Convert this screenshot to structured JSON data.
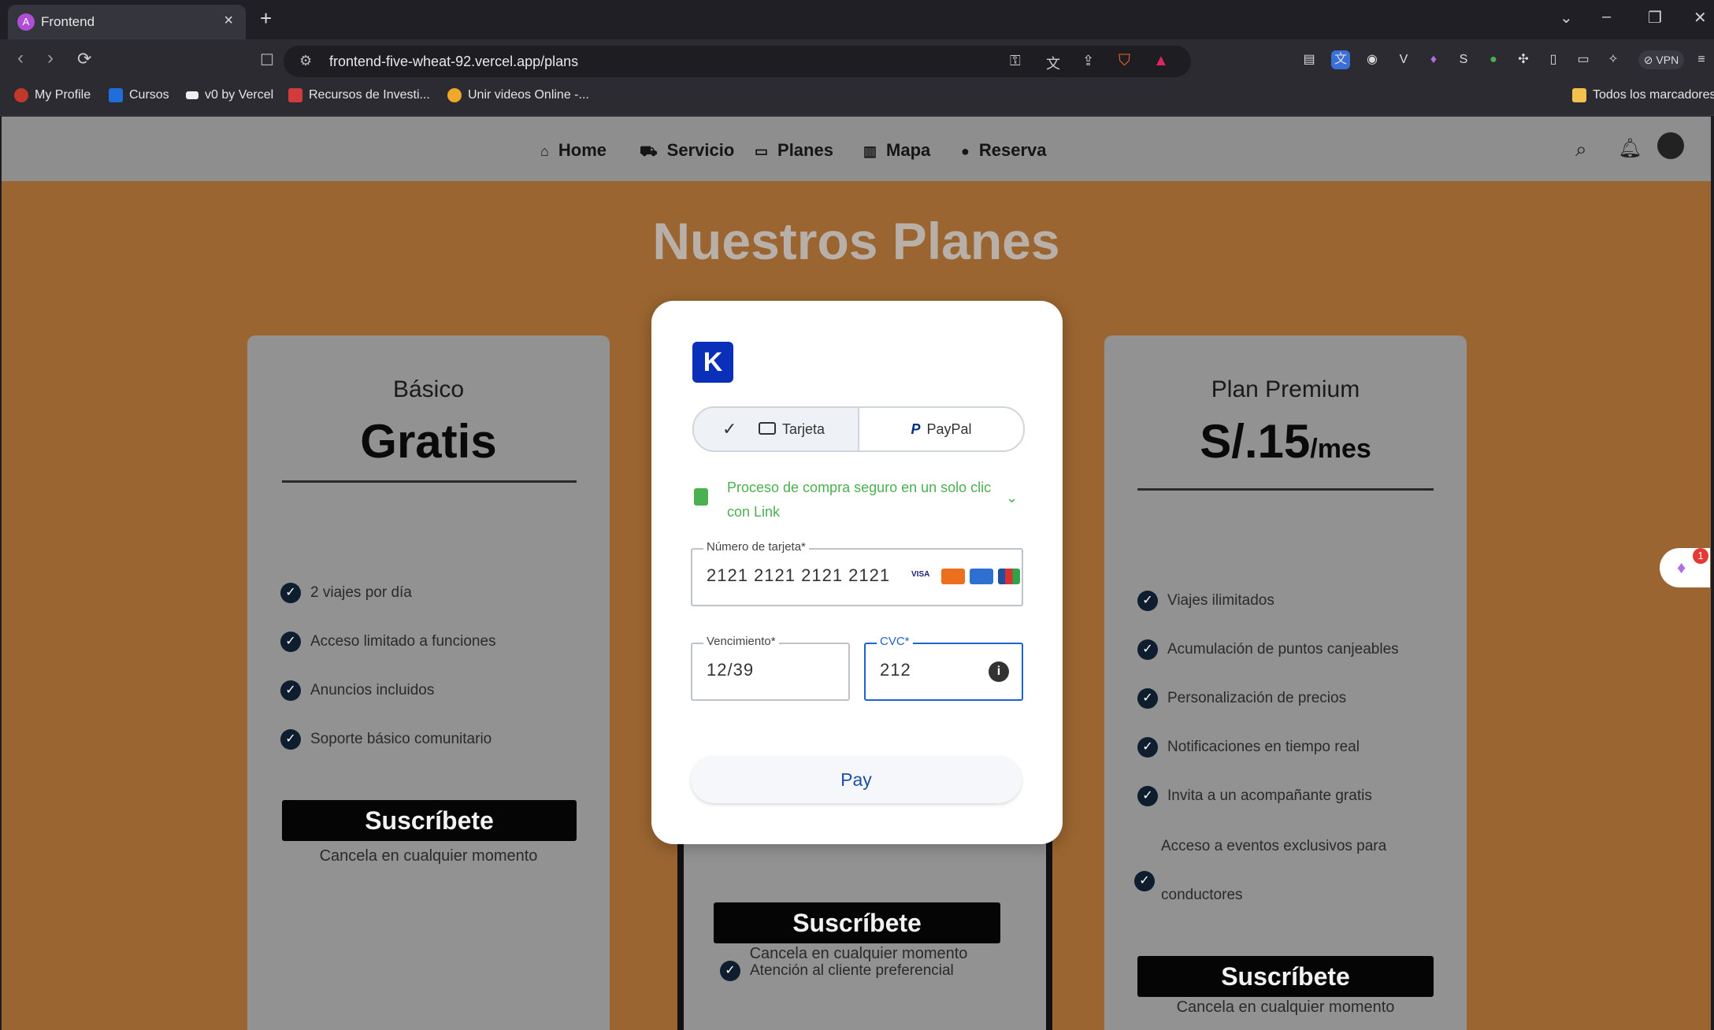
{
  "browser": {
    "tab_title": "Frontend",
    "tab_close": "×",
    "new_tab": "+",
    "url": "frontend-five-wheat-92.vercel.app/plans",
    "vpn_label": "VPN",
    "bookmarks": [
      "My Profile",
      "Cursos",
      "v0 by Vercel",
      "Recursos de Investi...",
      "Unir videos Online -..."
    ],
    "all_bookmarks": "Todos los marcadores"
  },
  "nav": {
    "items": [
      "Home",
      "Servicio",
      "Planes",
      "Mapa",
      "Reserva"
    ]
  },
  "page": {
    "title": "Nuestros Planes"
  },
  "plans": {
    "basic": {
      "name": "Básico",
      "price": "Gratis",
      "features": [
        "2 viajes por día",
        "Acceso limitado a funciones",
        "Anuncios incluidos",
        "Soporte básico comunitario"
      ],
      "button": "Suscríbete",
      "cancel": "Cancela en cualquier momento"
    },
    "middle": {
      "feature_partial": "Atención al cliente preferencial",
      "button": "Suscríbete",
      "cancel": "Cancela en cualquier momento"
    },
    "premium": {
      "name": "Plan Premium",
      "price": "S/.15",
      "period": "/mes",
      "features": [
        "Viajes ilimitados",
        "Acumulación de puntos canjeables",
        "Personalización de precios",
        "Notificaciones en tiempo real",
        "Invita a un acompañante gratis"
      ],
      "feature_multiline_1": "Acceso a eventos exclusivos para",
      "feature_multiline_2": "conductores",
      "button": "Suscríbete",
      "cancel": "Cancela en cualquier momento"
    }
  },
  "payment": {
    "tab_card": "Tarjeta",
    "tab_paypal": "PayPal",
    "secure_text": "Proceso de compra seguro en un solo clic con Link",
    "card_number_label": "Número de tarjeta*",
    "card_number": "2121 2121 2121 2121",
    "expiry_label": "Vencimiento*",
    "expiry": "12/39",
    "cvc_label": "CVC*",
    "cvc": "212",
    "pay_button": "Pay",
    "card_brands": [
      "VISA",
      "mastercard",
      "amex",
      "JCB"
    ]
  },
  "widget": {
    "badge": "1"
  },
  "colors": {
    "page_bg": "#9a6530",
    "header_bg": "#8e8e8e",
    "card_bg": "#929292",
    "accent_blue": "#0a2fb8",
    "secure_green": "#4caf50"
  }
}
